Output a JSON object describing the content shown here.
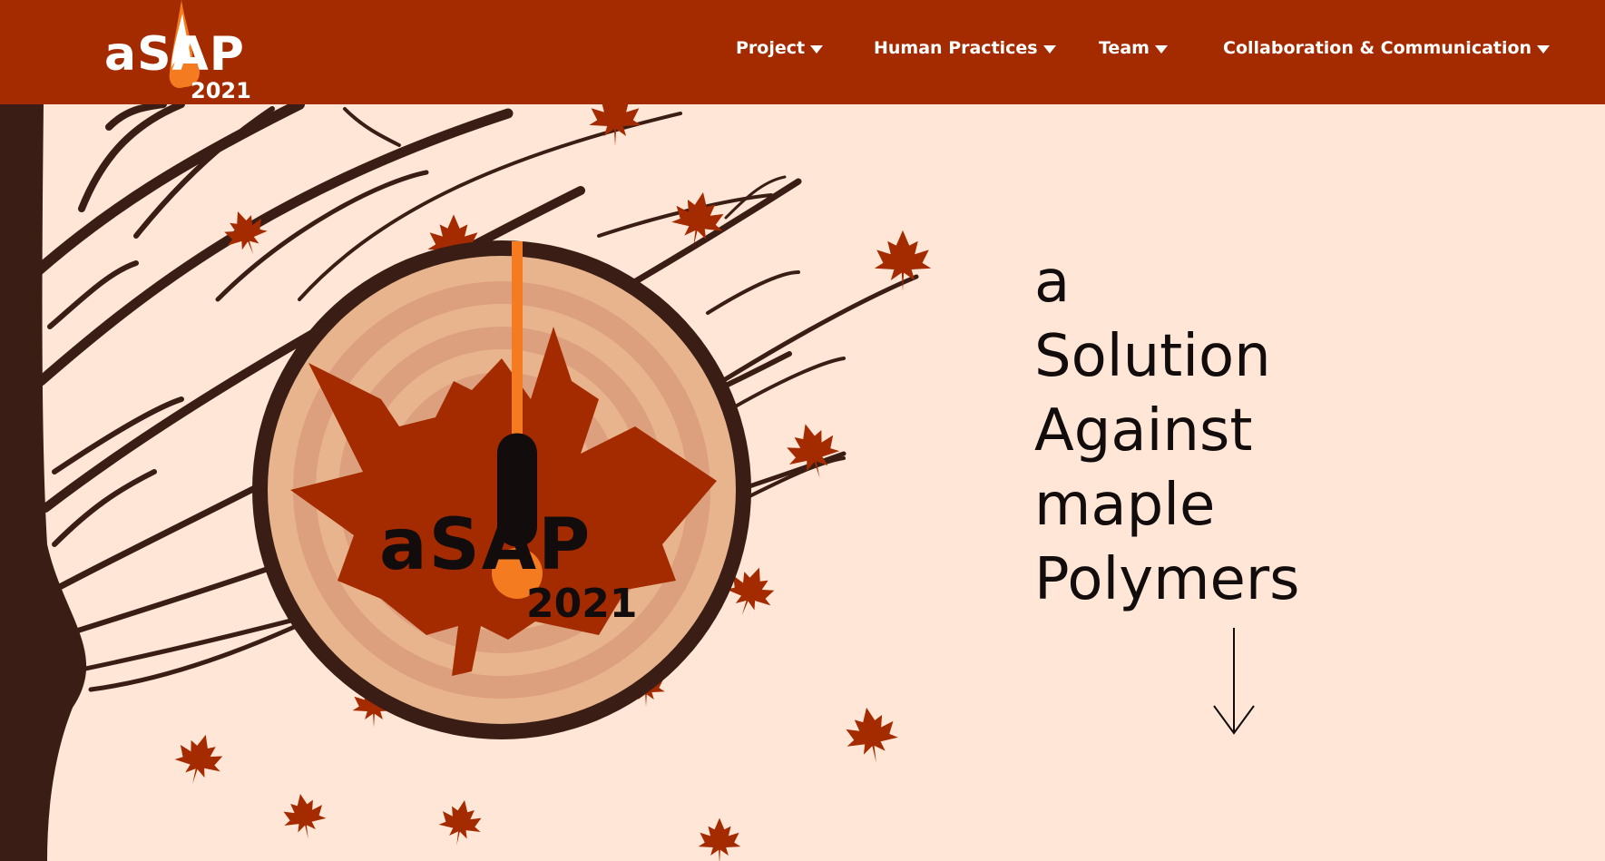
{
  "brand": {
    "name": "aSAP",
    "year": "2021"
  },
  "nav": {
    "items": [
      {
        "label": "Project",
        "icon": "caret-down-icon"
      },
      {
        "label": "Human Practices",
        "icon": "caret-down-icon"
      },
      {
        "label": "Team",
        "icon": "caret-down-icon"
      },
      {
        "label": "Collaboration & Communication",
        "icon": "caret-down-icon"
      }
    ]
  },
  "hero": {
    "emblem_text": "aSAP",
    "emblem_year": "2021",
    "tagline": [
      "a",
      "Solution",
      "Against",
      "maple",
      "Polymers"
    ],
    "scroll_icon": "arrow-down-icon"
  },
  "colors": {
    "nav_bg": "#A42B00",
    "page_bg": "#FFE6D6",
    "tree": "#3A1E15",
    "leaf": "#A42B00",
    "sap": "#F47B1F",
    "text": "#120C0C"
  }
}
